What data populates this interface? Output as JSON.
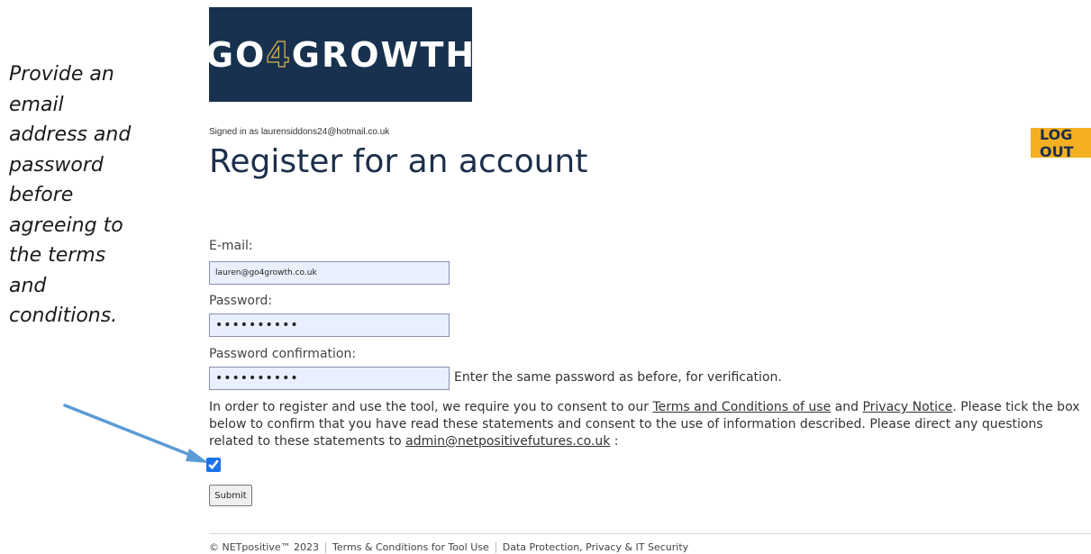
{
  "annotation": {
    "lines": [
      "Provide an",
      "email",
      "address and",
      "password",
      "before",
      "agreeing to",
      "the terms",
      "and",
      "conditions."
    ],
    "arrow_color": "#5b9bd5"
  },
  "header": {
    "logo": {
      "part1": "GO",
      "part2": "4",
      "part3": "GROWTH",
      "bg_color": "#17314e",
      "accent_color": "#e2b84a"
    },
    "signed_in": "Signed in as laurensiddons24@hotmail.co.uk",
    "logout_label": "LOG OUT",
    "logout_color": "#f5b021"
  },
  "page_title": "Register for an account",
  "form": {
    "email_label": "E-mail:",
    "email_value": "lauren@go4growth.co.uk",
    "password_label": "Password:",
    "password_value": "••••••••••",
    "password_confirm_label": "Password confirmation:",
    "password_confirm_value": "••••••••••",
    "password_confirm_help": "Enter the same password as before, for verification.",
    "consent": {
      "text1": "In order to register and use the tool, we require you to consent to our ",
      "terms_link": "Terms and Conditions of use",
      "text2": " and ",
      "privacy_link": "Privacy Notice",
      "text3": ". Please tick the box below to confirm that you have read these statements and consent to the use of information described. Please direct any questions related to these statements to ",
      "email_link": "admin@netpositivefutures.co.uk",
      "text4": " :"
    },
    "consent_checked": true,
    "submit_label": "Submit"
  },
  "footer": {
    "copyright": "© NETpositive™ 2023",
    "terms_link": "Terms & Conditions for Tool Use",
    "privacy_link": "Data Protection, Privacy & IT Security"
  }
}
